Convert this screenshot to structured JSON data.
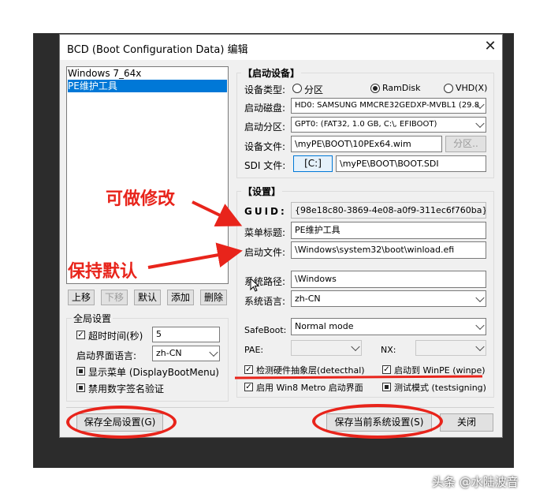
{
  "window": {
    "title": "BCD (Boot Configuration Data) 编辑",
    "close_glyph": "✕"
  },
  "entries": {
    "items": [
      {
        "label": "Windows 7_64x"
      },
      {
        "label": "PE维护工具"
      }
    ]
  },
  "list_buttons": {
    "up": "上移",
    "down": "下移",
    "default": "默认",
    "add": "添加",
    "delete": "删除"
  },
  "global": {
    "title": "全局设置",
    "timeout_label": "超时时间(秒)",
    "timeout_value": "5",
    "lang_label": "启动界面语言:",
    "lang_value": "zh-CN",
    "show_menu": "显示菜单 (DisplayBootMenu)",
    "no_sig": "禁用数字签名验证"
  },
  "boot_device": {
    "title": "【启动设备】",
    "type_label": "设备类型:",
    "types": [
      "分区",
      "RamDisk",
      "VHD(X)"
    ],
    "disk_label": "启动磁盘:",
    "disk_value": "HD0: SAMSUNG MMCRE32GEDXP-MVBL1 (29.8",
    "partition_label": "启动分区:",
    "partition_value": "GPT0: (FAT32,    1.0 GB, C:\\, EFIBOOT)",
    "file_label": "设备文件:",
    "file_value": "\\myPE\\BOOT\\10PEx64.wim",
    "partition_btn": "分区..",
    "sdi_label": "SDI 文件:",
    "sdi_drive": "[C:]",
    "sdi_value": "\\myPE\\BOOT\\BOOT.SDI"
  },
  "settings": {
    "title": "【设置】",
    "guid_label": "GUID:",
    "guid_value": "{98e18c80-3869-4e08-a0f9-311ec6f760ba}",
    "menu_title_label": "菜单标题:",
    "menu_title_value": "PE维护工具",
    "boot_file_label": "启动文件:",
    "boot_file_value": "\\Windows\\system32\\boot\\winload.efi",
    "sys_path_label": "系统路径:",
    "sys_path_value": "\\Windows",
    "sys_lang_label": "系统语言:",
    "sys_lang_value": "zh-CN",
    "safeboot_label": "SafeBoot:",
    "safeboot_value": "Normal mode",
    "pae_label": "PAE:",
    "nx_label": "NX:",
    "detecthal": "检测硬件抽象层(detecthal)",
    "winpe": "启动到 WinPE (winpe)",
    "win8metro": "启用 Win8 Metro 启动界面",
    "testsigning": "测试模式 (testsigning)"
  },
  "footer": {
    "save_global": "保存全局设置(G)",
    "save_current": "保存当前系统设置(S)",
    "close": "关闭"
  },
  "annotations": {
    "editable": "可做修改",
    "keep_default": "保持默认",
    "color": "#e8241b"
  },
  "watermark": "头条 @水陆波音"
}
